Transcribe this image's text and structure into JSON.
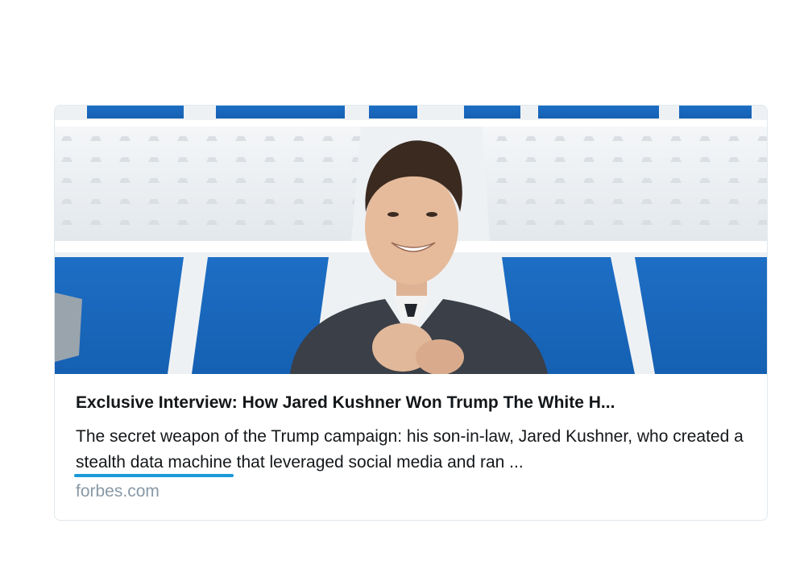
{
  "link_card": {
    "title": "Exclusive Interview: How Jared Kushner Won Trump The White H...",
    "description_before": "The secret weapon of the Trump campaign: his son-in-law, Jared Kushner, who created a ",
    "description_highlight": "stealth data machine",
    "description_after": " that leveraged social media and ran ...",
    "domain": "forbes.com",
    "image_alt": "Jared Kushner"
  },
  "colors": {
    "highlight_underline": "#1a9ad9",
    "domain_text": "#8899a6",
    "title_text": "#14171a",
    "card_border": "#e1e8ed"
  }
}
